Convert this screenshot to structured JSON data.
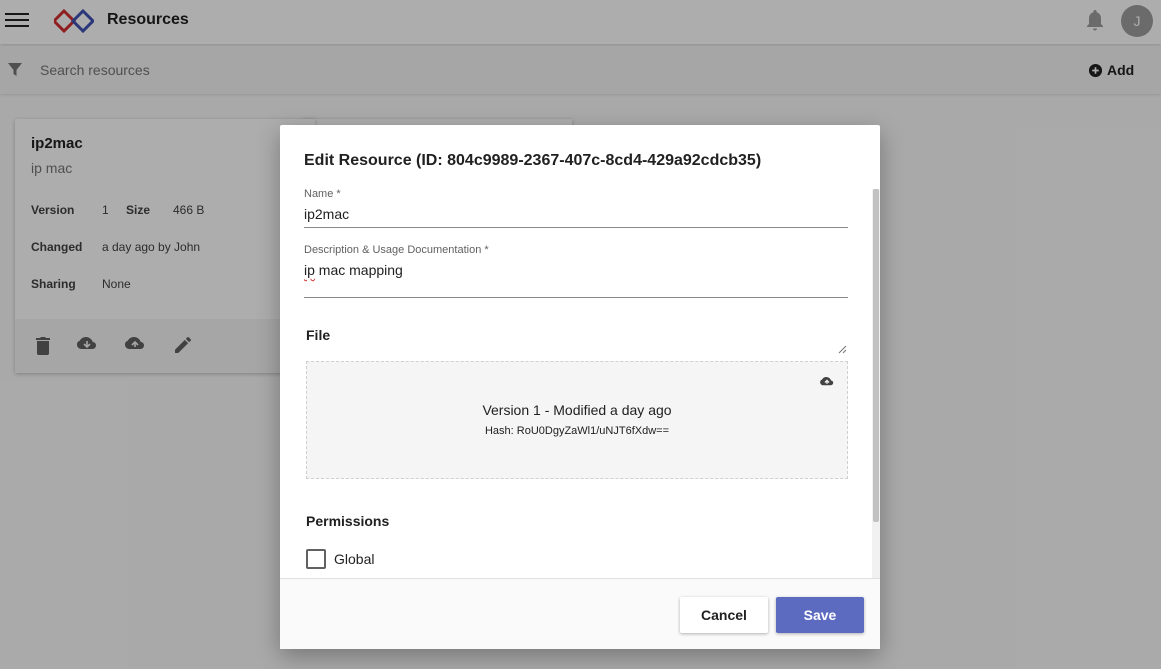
{
  "appbar": {
    "title": "Resources",
    "avatar_initial": "J",
    "brand_colors": {
      "red": "#d32f2f",
      "blue": "#3f51b5"
    },
    "icons": [
      "menu-icon",
      "logo-icon",
      "bell-icon"
    ]
  },
  "search": {
    "placeholder": "Search resources",
    "value": "",
    "add_label": "Add",
    "icons": [
      "filter-icon",
      "add-circle-icon"
    ]
  },
  "card": {
    "title": "ip2mac",
    "subtitle": "ip mac",
    "version_label": "Version",
    "version_value": "1",
    "size_label": "Size",
    "size_value": "466 B",
    "changed_label": "Changed",
    "changed_value": "a day ago by John",
    "sharing_label": "Sharing",
    "sharing_value": "None",
    "actions": [
      "delete-icon",
      "cloud-download-icon",
      "cloud-upload-icon",
      "edit-icon"
    ]
  },
  "dialog": {
    "title": "Edit Resource (ID: 804c9989-2367-407c-8cd4-429a92cdcb35)",
    "name_label": "Name *",
    "name_value": "ip2mac",
    "desc_label": "Description & Usage Documentation *",
    "desc_value_first_word": "ip",
    "desc_value_rest": " mac mapping",
    "file_section": "File",
    "file_version": "Version 1 - Modified a day ago",
    "file_hash": "Hash: RoU0DgyZaWl1/uNJT6fXdw==",
    "permissions_section": "Permissions",
    "global_label": "Global",
    "global_checked": false,
    "cancel_label": "Cancel",
    "save_label": "Save",
    "accent_color": "#5c6bc0"
  }
}
